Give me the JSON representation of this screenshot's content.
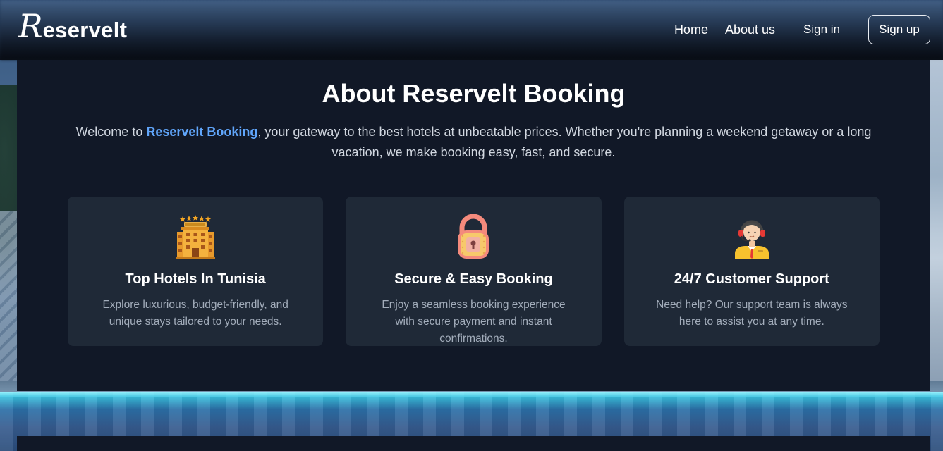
{
  "nav": {
    "logo_initial": "R",
    "logo_rest": "eservelt",
    "links": [
      "Home",
      "About us",
      "Sign in"
    ],
    "signup": "Sign up"
  },
  "about": {
    "title": "About Reservelt Booking",
    "intro_prefix": "Welcome to ",
    "intro_brand": "Reservelt Booking",
    "intro_suffix": ", your gateway to the best hotels at unbeatable prices. Whether you're planning a weekend getaway or a long vacation, we make booking easy, fast, and secure.",
    "cards": [
      {
        "icon": "hotel-icon",
        "title": "Top Hotels In Tunisia",
        "desc": "Explore luxurious, budget-friendly, and unique stays tailored to your needs."
      },
      {
        "icon": "padlock-icon",
        "title": "Secure & Easy Booking",
        "desc": "Enjoy a seamless booking experience with secure payment and instant confirmations."
      },
      {
        "icon": "support-agent-icon",
        "title": "24/7 Customer Support",
        "desc": "Need help? Our support team is always here to assist you at any time."
      }
    ]
  },
  "colors": {
    "panel": "#111827",
    "card": "#1f2937",
    "accent": "#60a5fa"
  }
}
